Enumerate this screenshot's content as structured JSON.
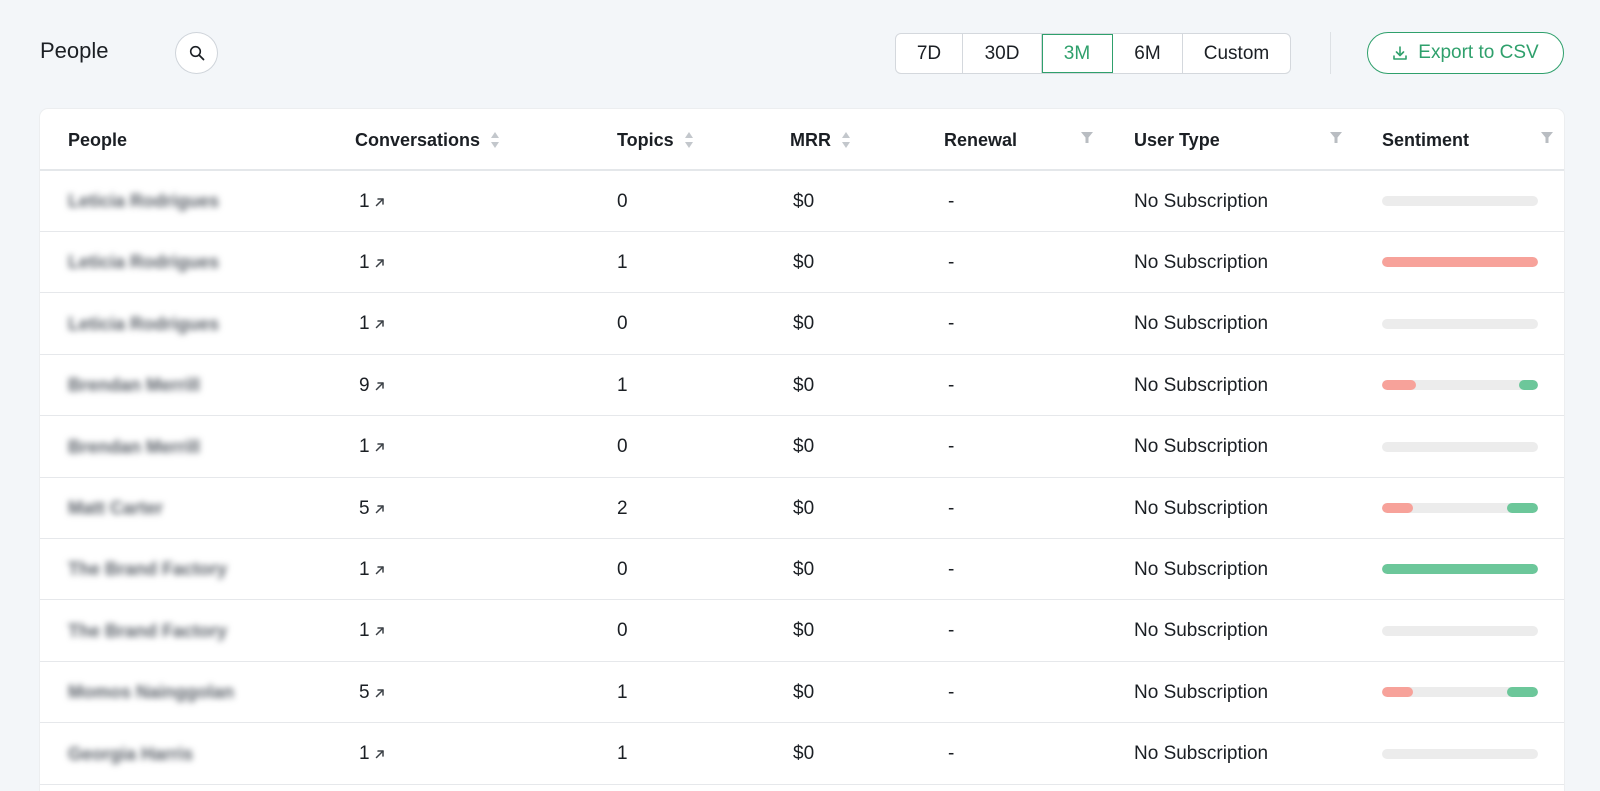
{
  "header": {
    "title": "People",
    "ranges": [
      "7D",
      "30D",
      "3M",
      "6M",
      "Custom"
    ],
    "active_range": "3M",
    "export_label": "Export to CSV"
  },
  "table": {
    "columns": {
      "people": "People",
      "conversations": "Conversations",
      "topics": "Topics",
      "mrr": "MRR",
      "renewal": "Renewal",
      "user_type": "User Type",
      "sentiment": "Sentiment"
    },
    "rows": [
      {
        "name": "Leticia Rodrigues",
        "conversations": "1",
        "topics": "0",
        "mrr": "$0",
        "renewal": "-",
        "user_type": "No Subscription",
        "sentiment": {
          "negative": 0,
          "positive": 0
        }
      },
      {
        "name": "Leticia Rodrigues",
        "conversations": "1",
        "topics": "1",
        "mrr": "$0",
        "renewal": "-",
        "user_type": "No Subscription",
        "sentiment": {
          "negative": 1,
          "positive": 0
        }
      },
      {
        "name": "Leticia Rodrigues",
        "conversations": "1",
        "topics": "0",
        "mrr": "$0",
        "renewal": "-",
        "user_type": "No Subscription",
        "sentiment": {
          "negative": 0,
          "positive": 0
        }
      },
      {
        "name": "Brendan Merrill",
        "conversations": "9",
        "topics": "1",
        "mrr": "$0",
        "renewal": "-",
        "user_type": "No Subscription",
        "sentiment": {
          "negative": 0.22,
          "positive": 0.12
        }
      },
      {
        "name": "Brendan Merrill",
        "conversations": "1",
        "topics": "0",
        "mrr": "$0",
        "renewal": "-",
        "user_type": "No Subscription",
        "sentiment": {
          "negative": 0,
          "positive": 0
        }
      },
      {
        "name": "Matt Carter",
        "conversations": "5",
        "topics": "2",
        "mrr": "$0",
        "renewal": "-",
        "user_type": "No Subscription",
        "sentiment": {
          "negative": 0.2,
          "positive": 0.2
        }
      },
      {
        "name": "The Brand Factory",
        "conversations": "1",
        "topics": "0",
        "mrr": "$0",
        "renewal": "-",
        "user_type": "No Subscription",
        "sentiment": {
          "negative": 0,
          "positive": 1
        }
      },
      {
        "name": "The Brand Factory",
        "conversations": "1",
        "topics": "0",
        "mrr": "$0",
        "renewal": "-",
        "user_type": "No Subscription",
        "sentiment": {
          "negative": 0,
          "positive": 0
        }
      },
      {
        "name": "Momos Nainggolan",
        "conversations": "5",
        "topics": "1",
        "mrr": "$0",
        "renewal": "-",
        "user_type": "No Subscription",
        "sentiment": {
          "negative": 0.2,
          "positive": 0.2
        }
      },
      {
        "name": "Georgia Harris",
        "conversations": "1",
        "topics": "1",
        "mrr": "$0",
        "renewal": "-",
        "user_type": "No Subscription",
        "sentiment": {
          "negative": 0,
          "positive": 0
        }
      }
    ]
  },
  "colors": {
    "accent": "#2fa06c",
    "sentiment_negative": "#f7a29a",
    "sentiment_positive": "#6cc79a",
    "sentiment_track": "#ececec"
  },
  "icons": {
    "search": "search-icon",
    "export": "download-icon",
    "sort": "sort-icon",
    "filter": "filter-icon",
    "conversation_link": "arrow-up-right-icon"
  }
}
